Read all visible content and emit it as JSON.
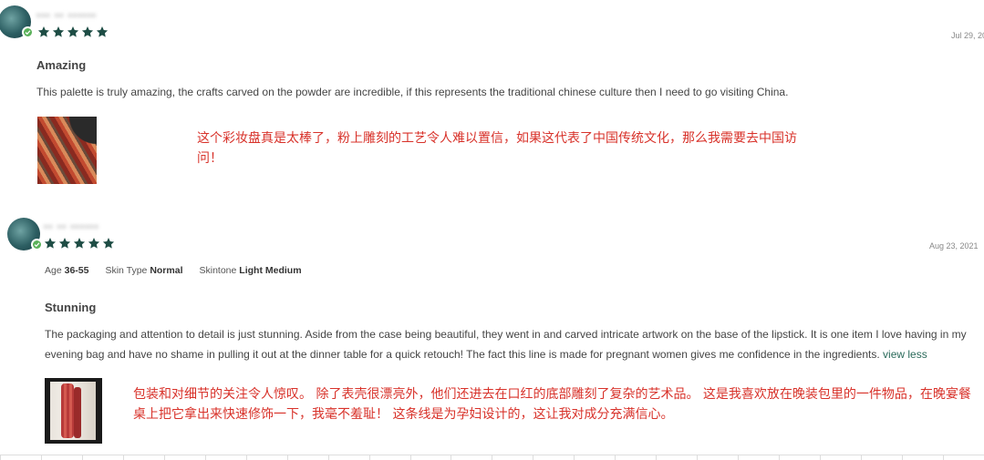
{
  "colors": {
    "star": "#1e4d45",
    "translation": "#d8322a",
    "verified": "#5ab15a",
    "link": "#2a6a5a"
  },
  "reviews": [
    {
      "username": "••• •• ••••••",
      "rating": 5,
      "date": "Jul 29, 20",
      "headline": "Amazing",
      "body": "This palette is truly amazing, the crafts carved on the powder are incredible, if this represents the traditional chinese culture then I need to go visiting China.",
      "image": "palette-photo",
      "translation": "这个彩妆盘真是太棒了，粉上雕刻的工艺令人难以置信，如果这代表了中国传统文化，那么我需要去中国访问！"
    },
    {
      "username": "•• •• ••••••",
      "rating": 5,
      "date": "Aug 23, 2021",
      "attributes": [
        {
          "label": "Age",
          "value": "36-55"
        },
        {
          "label": "Skin Type",
          "value": "Normal"
        },
        {
          "label": "Skintone",
          "value": "Light Medium"
        }
      ],
      "headline": "Stunning",
      "body": "The packaging and attention to detail is just stunning. Aside from the case being beautiful, they went in and carved intricate artwork on the base of the lipstick. It is one item I love having in my evening bag and have no shame in pulling it out at the dinner table for a quick retouch! The fact this line is made for pregnant women gives me confidence in the ingredients.",
      "view_less": "view less",
      "image": "lipstick-photo",
      "translation": "包装和对细节的关注令人惊叹。 除了表壳很漂亮外，他们还进去在口红的底部雕刻了复杂的艺术品。 这是我喜欢放在晚装包里的一件物品，在晚宴餐桌上把它拿出来快速修饰一下，我毫不羞耻！ 这条线是为孕妇设计的，这让我对成分充满信心。"
    }
  ]
}
